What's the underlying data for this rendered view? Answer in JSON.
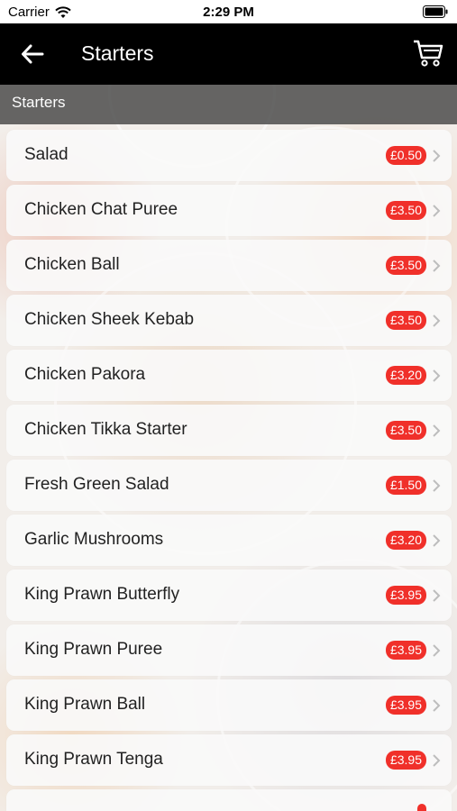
{
  "status_bar": {
    "carrier": "Carrier",
    "time": "2:29 PM"
  },
  "nav": {
    "title": "Starters"
  },
  "section": {
    "title": "Starters"
  },
  "items": [
    {
      "name": "Salad",
      "price": "£0.50"
    },
    {
      "name": "Chicken Chat Puree",
      "price": "£3.50"
    },
    {
      "name": "Chicken Ball",
      "price": "£3.50"
    },
    {
      "name": "Chicken Sheek Kebab",
      "price": "£3.50"
    },
    {
      "name": "Chicken Pakora",
      "price": "£3.20"
    },
    {
      "name": "Chicken Tikka Starter",
      "price": "£3.50"
    },
    {
      "name": "Fresh Green Salad",
      "price": "£1.50"
    },
    {
      "name": "Garlic Mushrooms",
      "price": "£3.20"
    },
    {
      "name": "King Prawn Butterfly",
      "price": "£3.95"
    },
    {
      "name": "King Prawn Puree",
      "price": "£3.95"
    },
    {
      "name": "King Prawn Ball",
      "price": "£3.95"
    },
    {
      "name": "King Prawn Tenga",
      "price": "£3.95"
    }
  ],
  "colors": {
    "nav_bg": "#000000",
    "price_badge": "#f0302a",
    "section_bg": "#464646"
  },
  "icons": {
    "back": "arrow-left-icon",
    "cart": "cart-icon",
    "row": "chevron-right-icon"
  }
}
